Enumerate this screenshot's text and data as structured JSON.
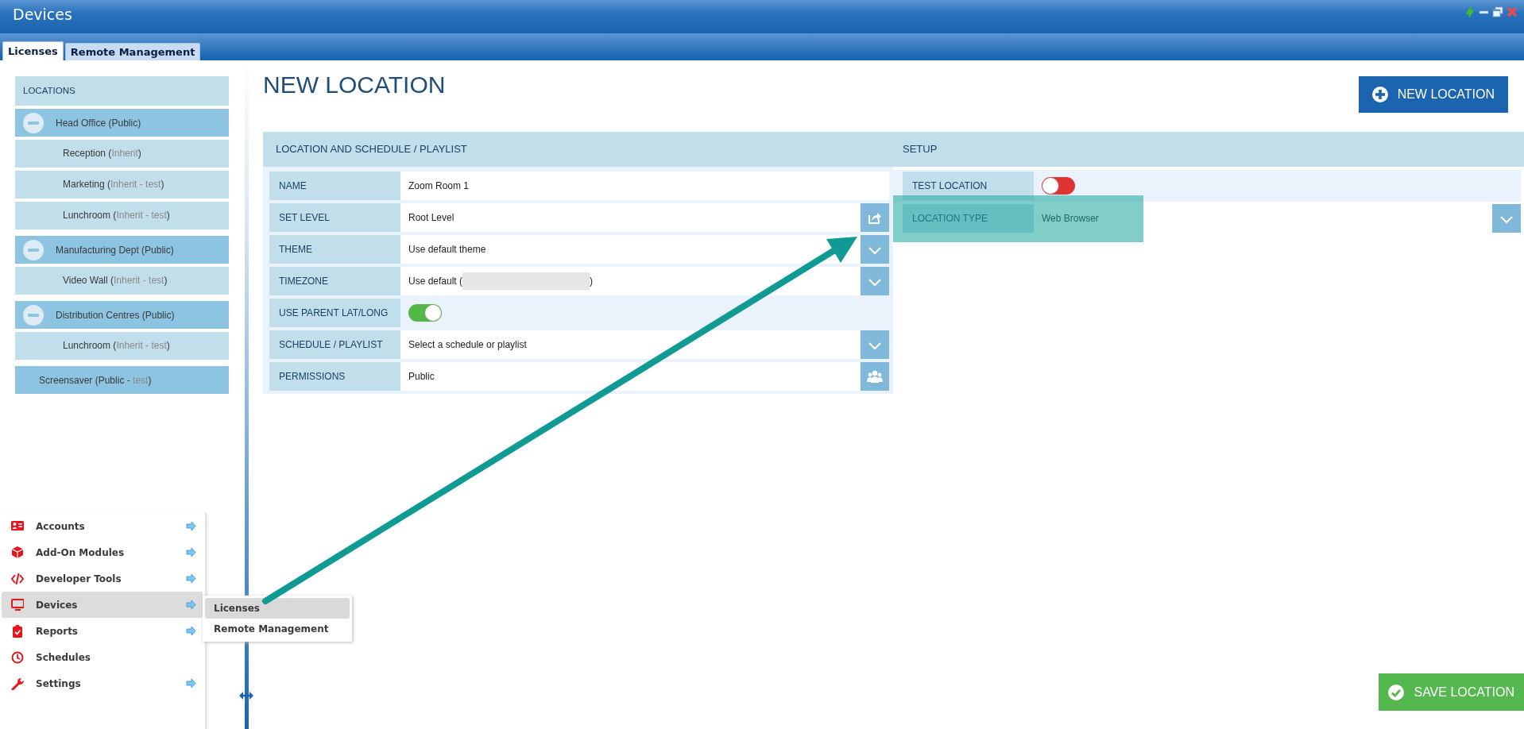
{
  "window": {
    "title": "Devices"
  },
  "tabs": [
    {
      "label": "Licenses",
      "selected": true
    },
    {
      "label": "Remote Management",
      "selected": false
    }
  ],
  "locations": {
    "header": "LOCATIONS",
    "items": [
      {
        "parts": [
          {
            "text": "Head Office (Public)",
            "muted": false
          }
        ],
        "expanded": true,
        "children": [
          {
            "parts": [
              {
                "text": "Reception (",
                "muted": false
              },
              {
                "text": "Inherit",
                "muted": true
              },
              {
                "text": ")",
                "muted": false
              }
            ]
          },
          {
            "parts": [
              {
                "text": "Marketing (",
                "muted": false
              },
              {
                "text": "Inherit - test",
                "muted": true
              },
              {
                "text": ")",
                "muted": false
              }
            ]
          },
          {
            "parts": [
              {
                "text": "Lunchroom (",
                "muted": false
              },
              {
                "text": "Inherit - test",
                "muted": true
              },
              {
                "text": ")",
                "muted": false
              }
            ]
          }
        ]
      },
      {
        "parts": [
          {
            "text": "Manufacturing Dept (Public)",
            "muted": false
          }
        ],
        "expanded": true,
        "children": [
          {
            "parts": [
              {
                "text": "Video Wall (",
                "muted": false
              },
              {
                "text": "Inherit - test",
                "muted": true
              },
              {
                "text": ")",
                "muted": false
              }
            ]
          }
        ]
      },
      {
        "parts": [
          {
            "text": "Distribution Centres (Public)",
            "muted": false
          }
        ],
        "expanded": true,
        "children": [
          {
            "parts": [
              {
                "text": "Lunchroom (",
                "muted": false
              },
              {
                "text": "Inherit - test",
                "muted": true
              },
              {
                "text": ")",
                "muted": false
              }
            ]
          }
        ]
      },
      {
        "parts": [
          {
            "text": "Screensaver (Public - ",
            "muted": false
          },
          {
            "text": "test",
            "muted": true
          },
          {
            "text": ")",
            "muted": false
          }
        ]
      }
    ]
  },
  "page_title": "NEW LOCATION",
  "new_button": "NEW LOCATION",
  "form": {
    "sections": [
      {
        "title": "LOCATION AND SCHEDULE / PLAYLIST",
        "rows": [
          {
            "label": "NAME",
            "kind": "text",
            "value": "Zoom Room 1"
          },
          {
            "label": "SET LEVEL",
            "kind": "text",
            "value": "Root Level",
            "button": {
              "kind": "share"
            }
          },
          {
            "label": "THEME",
            "kind": "text",
            "value": "Use default theme",
            "button": {
              "kind": "chevron"
            }
          },
          {
            "label": "TIMEZONE",
            "kind": "redacted",
            "value": "Use default (",
            "value_end": ")",
            "button": {
              "kind": "chevron"
            }
          },
          {
            "label": "USE PARENT LAT/LONG",
            "kind": "toggle",
            "on": true
          },
          {
            "label": "SCHEDULE / PLAYLIST",
            "kind": "text",
            "value": "Select a schedule or playlist",
            "button": {
              "kind": "chevron"
            }
          },
          {
            "label": "PERMISSIONS",
            "kind": "text",
            "value": "Public",
            "button": {
              "kind": "people"
            }
          }
        ]
      },
      {
        "title": "SETUP",
        "rows": [
          {
            "label": "TEST LOCATION",
            "kind": "toggle",
            "on": false
          },
          {
            "label": "LOCATION TYPE",
            "kind": "text",
            "value": "Web Browser",
            "button": {
              "kind": "chevron"
            }
          }
        ]
      }
    ]
  },
  "nav_menu": [
    {
      "label": "Accounts",
      "submenu": true,
      "selected": false
    },
    {
      "label": "Add-On Modules",
      "submenu": true,
      "selected": false
    },
    {
      "label": "Developer Tools",
      "submenu": true,
      "selected": false
    },
    {
      "label": "Devices",
      "submenu": true,
      "selected": true
    },
    {
      "label": "Reports",
      "submenu": true,
      "selected": false
    },
    {
      "label": "Schedules",
      "submenu": false,
      "selected": false
    },
    {
      "label": "Settings",
      "submenu": true,
      "selected": false
    }
  ],
  "submenu": [
    {
      "label": "Licenses",
      "selected": true
    },
    {
      "label": "Remote Management",
      "selected": false
    }
  ],
  "save_button": "SAVE LOCATION"
}
